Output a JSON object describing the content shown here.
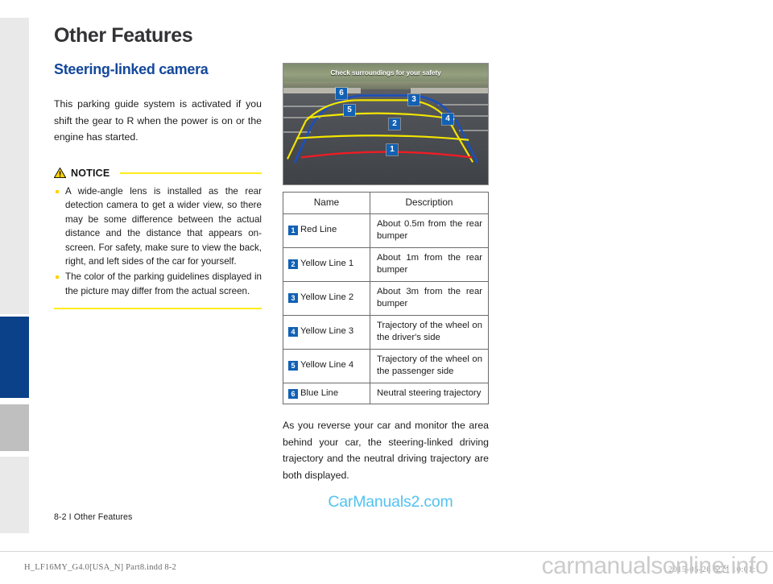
{
  "document": {
    "title": "Other Features",
    "section_heading": "Steering-linked camera",
    "intro_paragraph": "This parking guide system is activated if you shift the gear to R when the power is on or the engine has started.",
    "closing_paragraph": "As you reverse your car and monitor the area behind your car, the steering-linked driving trajectory and the neutral driving trajectory are both displayed.",
    "folio": "8-2 I Other Features"
  },
  "notice": {
    "label": "NOTICE",
    "icon": "warning-triangle-icon",
    "items": [
      "A wide-angle lens is installed as the rear detection camera to get a wider view, so there may be some difference between the actual distance and the distance that appears on-screen. For safety, make sure to view the back, right, and left sides of the car for yourself.",
      "The color of the parking guidelines displayed in the picture may differ from the actual screen."
    ]
  },
  "camera": {
    "banner_text": "Check surroundings for your safety",
    "badges": [
      "1",
      "2",
      "3",
      "4",
      "5",
      "6"
    ],
    "line_colors": {
      "red": "#ee1c25",
      "yellow": "#f2e500",
      "blue": "#1a4fbe"
    }
  },
  "table": {
    "headers": [
      "Name",
      "Description"
    ],
    "rows": [
      {
        "num": "1",
        "name": "Red Line",
        "description": "About 0.5m from the rear bumper"
      },
      {
        "num": "2",
        "name": "Yellow Line 1",
        "description": "About 1m from the rear bumper"
      },
      {
        "num": "3",
        "name": "Yellow Line 2",
        "description": "About 3m from the rear bumper"
      },
      {
        "num": "4",
        "name": "Yellow Line 3",
        "description": "Trajectory of the wheel on the driver's side"
      },
      {
        "num": "5",
        "name": "Yellow Line 4",
        "description": "Trajectory of the wheel on the passenger side"
      },
      {
        "num": "6",
        "name": "Blue Line",
        "description": "Neutral steering trajectory"
      }
    ]
  },
  "watermarks": {
    "center": "CarManuals2.com",
    "bottom_right": "carmanualsonline.info"
  },
  "print_bar": {
    "file": "H_LF16MY_G4.0[USA_N] Part8.indd   8-2",
    "date": "2015-05-26   오전 10:01:1"
  },
  "colors": {
    "heading_blue": "#13489c",
    "tab_active_blue": "#0b4188",
    "notice_yellow": "#ffeb1c",
    "watermark_blue": "#52c2f0"
  }
}
